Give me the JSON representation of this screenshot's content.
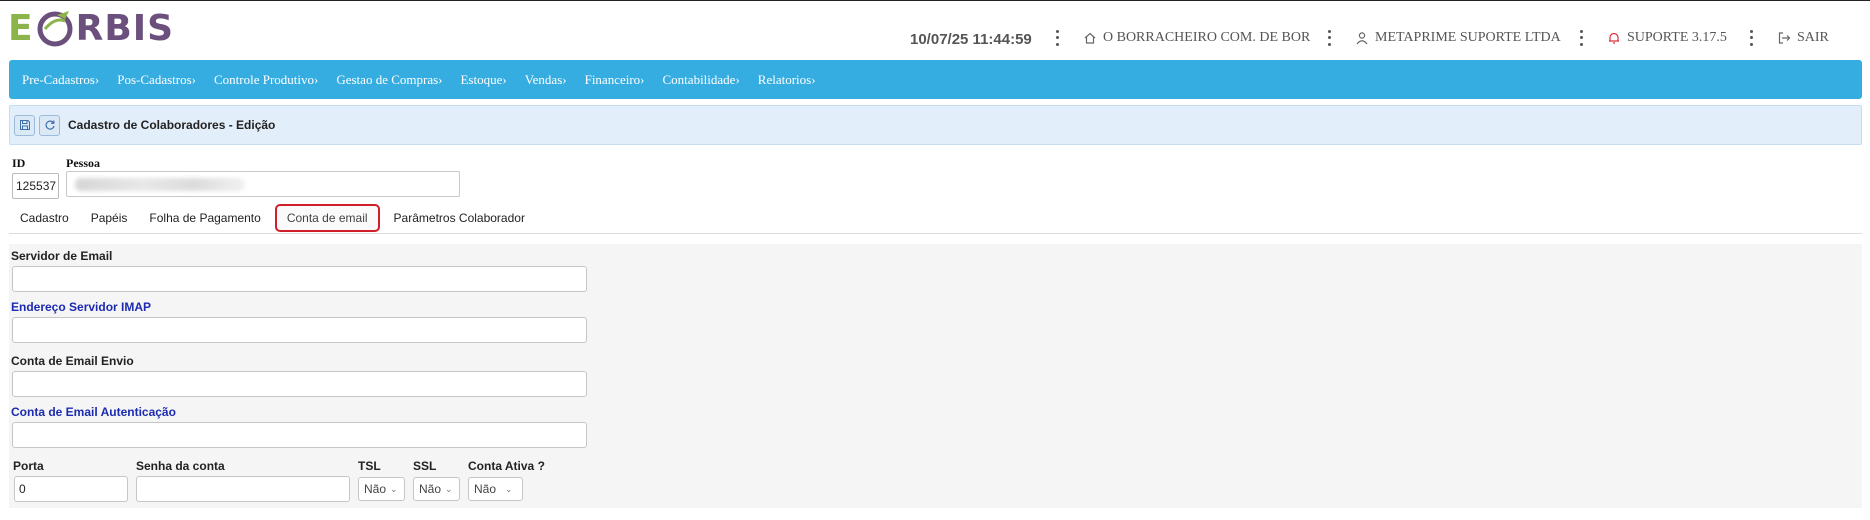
{
  "header": {
    "logo_left": "E",
    "logo_right": "RBIS",
    "datetime": "10/07/25 11:44:59",
    "company": "O BORRACHEIRO COM. DE BOR",
    "user": "METAPRIME SUPORTE LTDA",
    "support": "SUPORTE 3.17.5",
    "logout": "SAIR"
  },
  "nav": {
    "items": [
      "Pre-Cadastros›",
      "Pos-Cadastros›",
      "Controle Produtivo›",
      "Gestao de Compras›",
      "Estoque›",
      "Vendas›",
      "Financeiro›",
      "Contabilidade›",
      "Relatorios›"
    ]
  },
  "titlebar": {
    "title": "Cadastro de Colaboradores - Edição"
  },
  "record": {
    "id_label": "ID",
    "id_value": "125537",
    "pessoa_label": "Pessoa"
  },
  "tabs": [
    "Cadastro",
    "Papéis",
    "Folha de Pagamento",
    "Conta de email",
    "Parâmetros Colaborador"
  ],
  "form": {
    "servidor_label": "Servidor de Email",
    "servidor_value": "",
    "imap_label": "Endereço Servidor IMAP",
    "imap_value": "",
    "envio_label": "Conta de Email Envio",
    "envio_value": "",
    "auth_label": "Conta de Email Autenticação",
    "auth_value": "",
    "porta_label": "Porta",
    "porta_value": "0",
    "senha_label": "Senha da conta",
    "senha_value": "",
    "tsl_label": "TSL",
    "tsl_value": "Não",
    "ssl_label": "SSL",
    "ssl_value": "Não",
    "ativa_label": "Conta Ativa ?",
    "ativa_value": "Não"
  },
  "colors": {
    "nav_bg": "#36ade0",
    "titlebar_bg": "#e2eef9",
    "active_tab_border": "#d11f2a",
    "blue_label": "#1c2bb0",
    "support_bell": "#d9303a"
  }
}
